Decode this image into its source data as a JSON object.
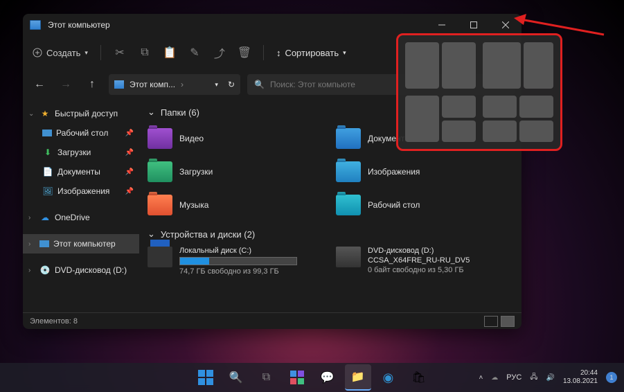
{
  "window": {
    "title": "Этот компьютер"
  },
  "toolbar": {
    "new_label": "Создать",
    "sort_label": "Сортировать"
  },
  "address": {
    "path": "Этот комп...",
    "search_placeholder": "Поиск: Этот компьюте"
  },
  "sidebar": {
    "quick": "Быстрый доступ",
    "desktop": "Рабочий стол",
    "downloads": "Загрузки",
    "documents": "Документы",
    "images": "Изображения",
    "onedrive": "OneDrive",
    "thispc": "Этот компьютер",
    "dvd": "DVD-дисковод (D:)"
  },
  "groups": {
    "folders": "Папки (6)",
    "drives": "Устройства и диски (2)"
  },
  "folders": {
    "video": "Видео",
    "documents": "Документы",
    "downloads": "Загрузки",
    "images": "Изображения",
    "music": "Музыка",
    "desktop": "Рабочий стол"
  },
  "drives": {
    "c_name": "Локальный диск (C:)",
    "c_free": "74,7 ГБ свободно из 99,3 ГБ",
    "c_fill_pct": 25,
    "d_name": "DVD-дисковод (D:)",
    "d_label": "CCSA_X64FRE_RU-RU_DV5",
    "d_free": "0 байт свободно из 5,30 ГБ"
  },
  "status": {
    "items": "Элементов: 8"
  },
  "tray": {
    "lang": "РУС",
    "time": "20:44",
    "date": "13.08.2021",
    "notif": "1"
  }
}
